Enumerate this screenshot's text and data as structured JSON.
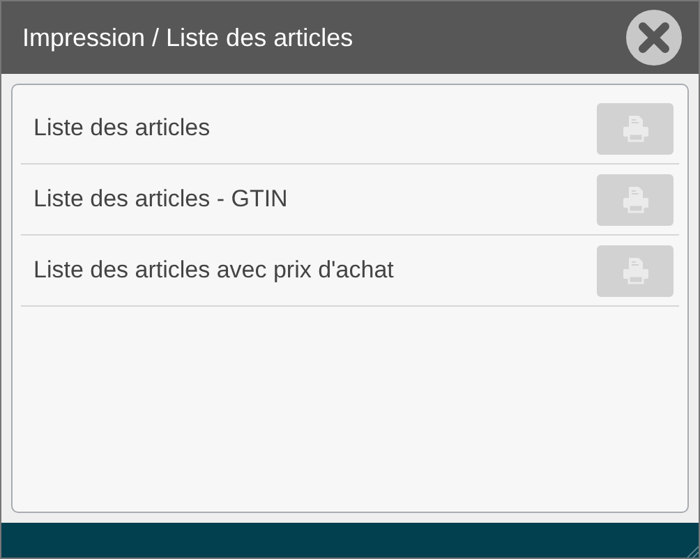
{
  "window": {
    "title": "Impression / Liste des articles"
  },
  "items": [
    {
      "label": "Liste des articles",
      "disabled": true
    },
    {
      "label": "Liste des articles - GTIN",
      "disabled": true
    },
    {
      "label": "Liste des articles avec prix d'achat",
      "disabled": true
    }
  ]
}
